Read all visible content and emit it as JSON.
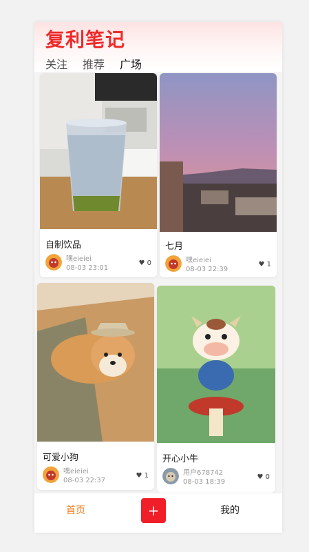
{
  "app": {
    "title": "复利笔记"
  },
  "tabs": [
    {
      "label": "关注"
    },
    {
      "label": "推荐"
    },
    {
      "label": "广场",
      "active": true
    }
  ],
  "posts": [
    {
      "title": "自制饮品",
      "author": "嘿eieiei",
      "time": "08-03 23:01",
      "likes": "0",
      "image": "drink-photo",
      "avatar": "cow-avatar"
    },
    {
      "title": "七月",
      "author": "嘿eieiei",
      "time": "08-03 22:39",
      "likes": "1",
      "image": "sunset-city-photo",
      "avatar": "cow-avatar"
    },
    {
      "title": "可爱小狗",
      "author": "嘿eieiei",
      "time": "08-03 22:37",
      "likes": "1",
      "image": "shiba-dog-photo",
      "avatar": "cow-avatar"
    },
    {
      "title": "开心小牛",
      "author": "用户678742",
      "time": "08-03 18:39",
      "likes": "0",
      "image": "cartoon-cow-image",
      "avatar": "cat-avatar"
    }
  ],
  "nav": {
    "home": "首页",
    "add": "+",
    "mine": "我的"
  },
  "colors": {
    "accent": "#ef2a2a",
    "home_active": "#f07a1a"
  },
  "icons": {
    "like": "heart-icon"
  }
}
